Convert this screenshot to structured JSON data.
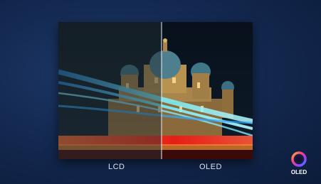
{
  "comparison": {
    "left_label": "LCD",
    "right_label": "OLED"
  },
  "badge": {
    "text": "OLED"
  },
  "colors": {
    "background": "#142a52",
    "light_trail_cyan": "#3fd6ff",
    "light_trail_red": "#ff2b1c"
  }
}
